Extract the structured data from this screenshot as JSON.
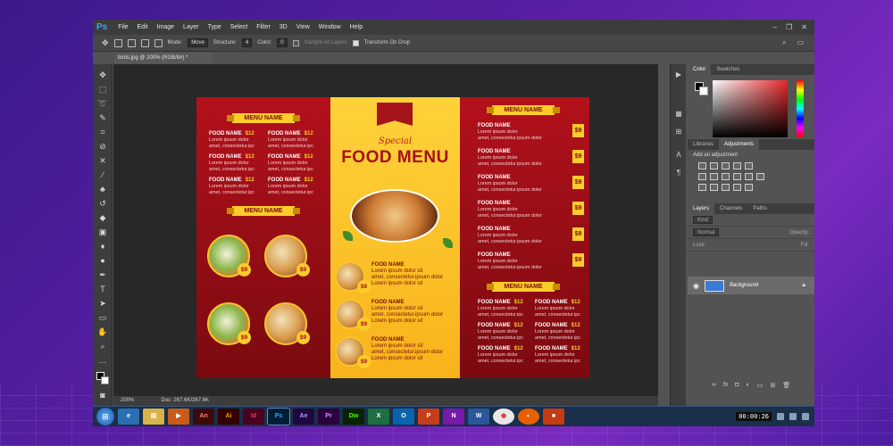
{
  "app": {
    "name": "Ps",
    "menu": [
      "File",
      "Edit",
      "Image",
      "Layer",
      "Type",
      "Select",
      "Filter",
      "3D",
      "View",
      "Window",
      "Help"
    ]
  },
  "options": {
    "mode_label": "Mode:",
    "mode_value": "Move",
    "structure_label": "Structure:",
    "structure_value": "4",
    "color_label": "Color:",
    "color_value": "0",
    "sample_label": "Sample All Layers",
    "transform_label": "Transform On Drop"
  },
  "doc_tab": "birds.jpg @ 200% (RGB/8#) *",
  "status": {
    "zoom": "200%",
    "doc": "Doc: 267.6K/267.6K"
  },
  "panels": {
    "color_tab": "Color",
    "swatches_tab": "Swatches",
    "libraries_tab": "Libraries",
    "adjustments_tab": "Adjustments",
    "adj_title": "Add an adjustment",
    "layers_tab": "Layers",
    "channels_tab": "Channels",
    "paths_tab": "Paths",
    "kind": "Kind",
    "normal": "Normal",
    "opacity": "Opacity:",
    "lock": "Lock:",
    "fill": "Fill:",
    "layer_name": "Background"
  },
  "menu": {
    "banner_main": "MENU NAME",
    "item_name": "FOOD NAME",
    "price12": "$12",
    "price9": "$9",
    "desc1": "Lorem ipsum dolor",
    "desc2": "amet, consectetur.ipc",
    "desc_long1": "Lorem ipsum dolor sit",
    "desc_long2": "amet, consectetur.ipsum dolor",
    "desc_long3": "Lorem ipsum dolor sit",
    "special": "Special",
    "food_menu": "FOOD MENU",
    "mid_item_name": "FOOD NAME"
  },
  "taskbar": {
    "clock": "00:00:26"
  }
}
